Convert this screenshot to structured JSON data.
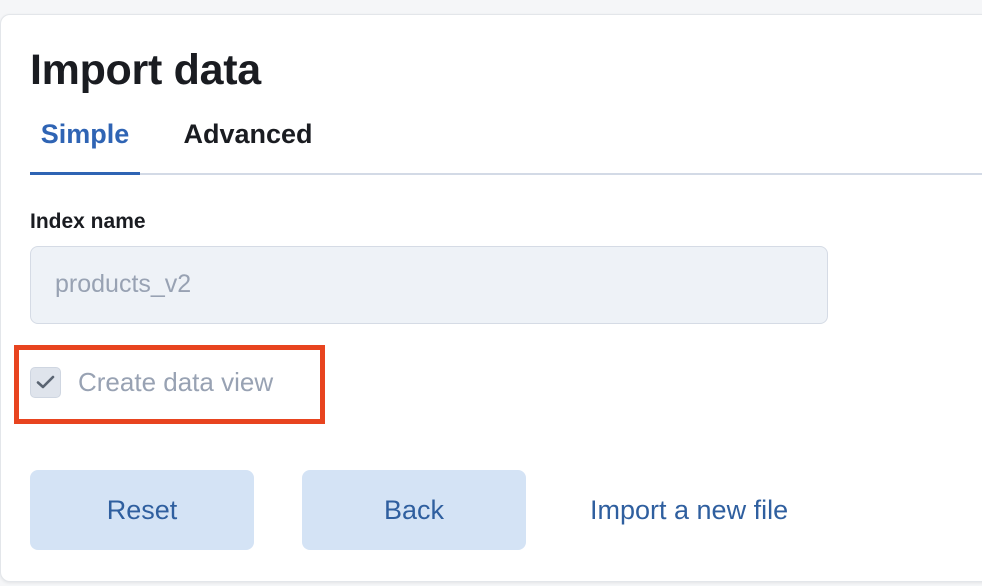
{
  "header": {
    "title": "Import data"
  },
  "tabs": [
    {
      "label": "Simple",
      "selected": true
    },
    {
      "label": "Advanced",
      "selected": false
    }
  ],
  "form": {
    "index_name_label": "Index name",
    "index_name_value": "products_v2",
    "create_data_view_label": "Create data view",
    "create_data_view_checked": true
  },
  "actions": {
    "reset_label": "Reset",
    "back_label": "Back",
    "import_new_file_label": "Import a new file"
  },
  "colors": {
    "accent": "#2f64b4",
    "button_bg": "#d4e3f5",
    "highlight": "#e8441f"
  }
}
